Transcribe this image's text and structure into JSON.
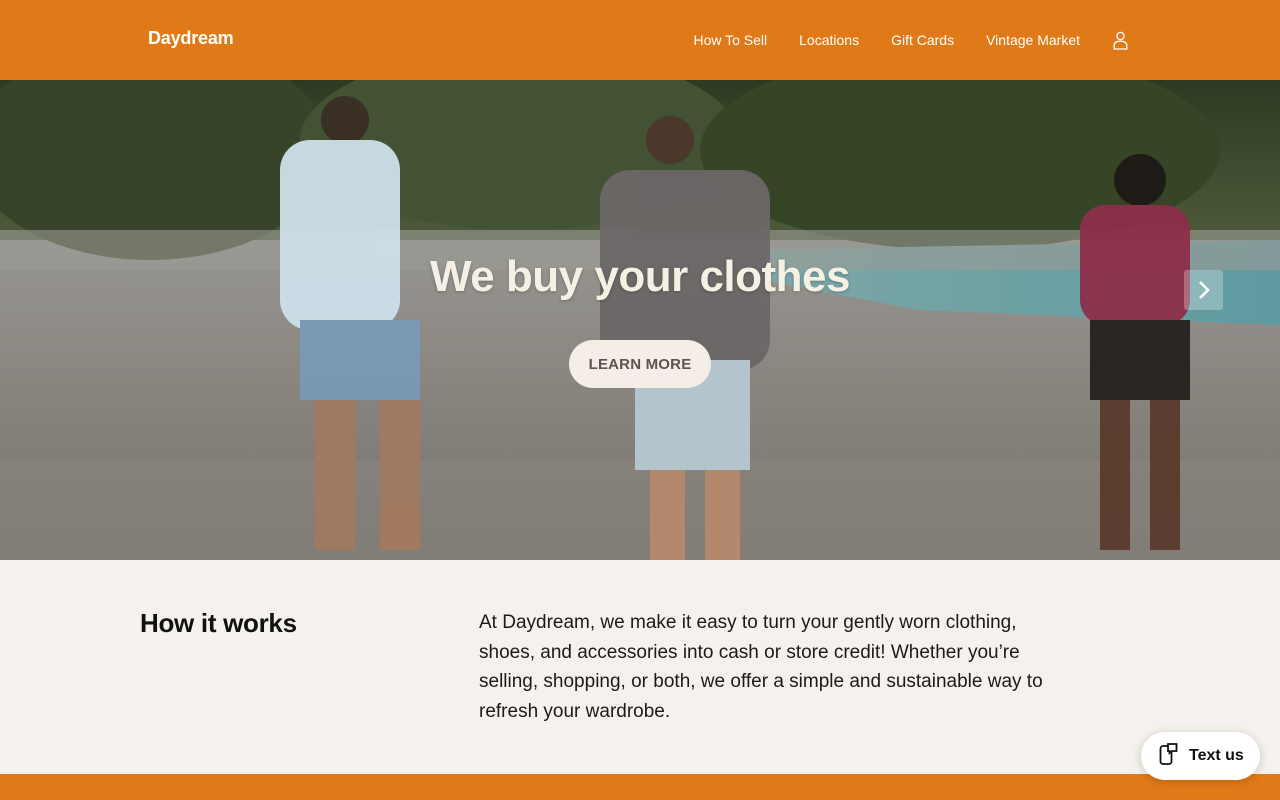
{
  "header": {
    "brand": "Daydream",
    "nav": [
      "How To Sell",
      "Locations",
      "Gift Cards",
      "Vintage Market"
    ],
    "account_icon": "user-icon"
  },
  "hero": {
    "title": "We buy your clothes",
    "cta_label": "LEARN MORE",
    "next_icon": "chevron-right-icon"
  },
  "how": {
    "title": "How it works",
    "body": "At Daydream, we make it easy to turn your gently worn clothing, shoes, and accessories into cash or store credit! Whether you’re selling, shopping, or both, we offer a simple and sustainable way to refresh your wardrobe."
  },
  "widget": {
    "label": "Text us",
    "icon": "chat-phone-icon"
  },
  "colors": {
    "brand_orange": "#e07a18",
    "page_bg": "#f5f1ec"
  }
}
